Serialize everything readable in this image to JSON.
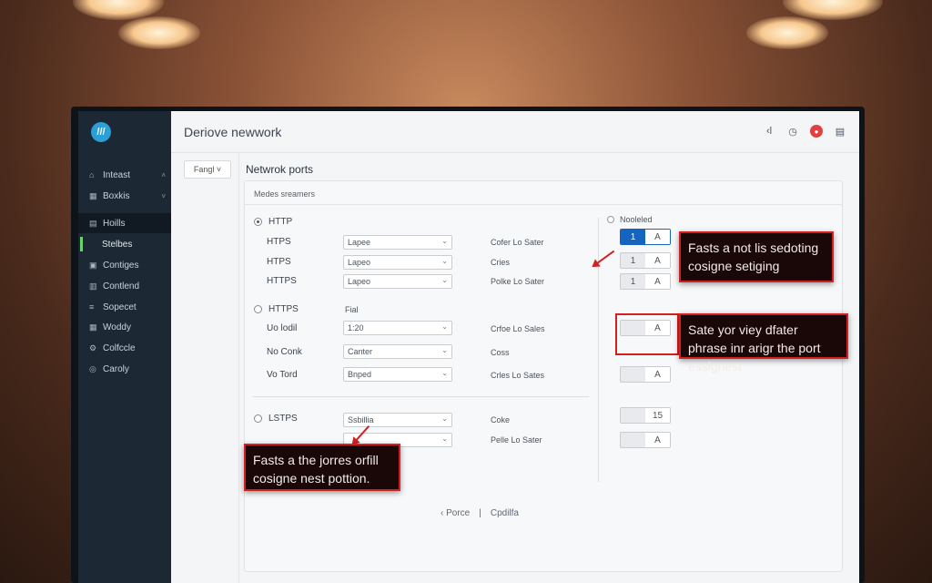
{
  "header": {
    "title": "Deriove newwork",
    "icons": [
      "back-icon",
      "clock-icon",
      "alert-icon",
      "calendar-icon"
    ]
  },
  "sidebar": {
    "items": [
      {
        "label": "Inteast",
        "icon": "home-icon"
      },
      {
        "label": "Boxkis",
        "icon": "grid-icon"
      },
      {
        "label": "Hoills",
        "icon": "host-icon"
      },
      {
        "label": "Stelbes",
        "icon": ""
      },
      {
        "label": "Contiges",
        "icon": "config-icon"
      },
      {
        "label": "Contlend",
        "icon": "content-icon"
      },
      {
        "label": "Sopecet",
        "icon": "list-icon"
      },
      {
        "label": "Woddy",
        "icon": "table-icon"
      },
      {
        "label": "Colfccle",
        "icon": "gear-icon"
      },
      {
        "label": "Caroly",
        "icon": "settings-icon"
      }
    ]
  },
  "filter": {
    "label": "Fangl"
  },
  "section_title": "Netwrok ports",
  "panel": {
    "header": "Medes sreamers",
    "groups": [
      {
        "radio_label": "HTTP",
        "rows": [
          {
            "label": "HTPS",
            "select": "Lapee",
            "right": "Cofer Lo Sater"
          },
          {
            "label": "HTPS",
            "select": "Lapeo",
            "right": "Cries"
          },
          {
            "label": "HTTPS",
            "select": "Lapeo",
            "right": "Polke Lo Sater"
          }
        ]
      },
      {
        "radio_label": "HTTPS",
        "col_header": "Fial",
        "rows": [
          {
            "label": "Uo lodil",
            "select": "1:20",
            "right": "Crfoe Lo Sales"
          },
          {
            "label": "No Conk",
            "select": "Canter",
            "right": "Coss"
          },
          {
            "label": "Vo Tord",
            "select": "Bnped",
            "right": "Crles Lo Sates"
          }
        ]
      },
      {
        "radio_label": "LSTPS",
        "rows": [
          {
            "label": "",
            "select": "Ssbillia",
            "right": "Coke"
          },
          {
            "label": "",
            "select": "",
            "right": "Pelle Lo Sater"
          }
        ]
      }
    ],
    "right_header": "Nooleled",
    "toggles": [
      {
        "a": "1",
        "b": "A",
        "active": true
      },
      {
        "a": "1",
        "b": "A"
      },
      {
        "a": "1",
        "b": "A"
      },
      {
        "a": "",
        "b": "A"
      },
      {
        "a": "",
        "b": "A"
      },
      {
        "a": "",
        "b": "15"
      },
      {
        "a": "",
        "b": "A"
      }
    ],
    "pager": {
      "prev": "‹ Porce",
      "sep": "|",
      "next": "Cpdilfa"
    }
  },
  "callouts": [
    "Fasts a not lis sedoting cosigne setiging",
    "Sate yor viey dfater phrase inr arigr the port essignest",
    "Fasts a the jorres orfill cosigne nest pottion."
  ],
  "colors": {
    "accent": "#1565c0",
    "callout": "#d21f1f",
    "sidebar": "#1c2833"
  }
}
